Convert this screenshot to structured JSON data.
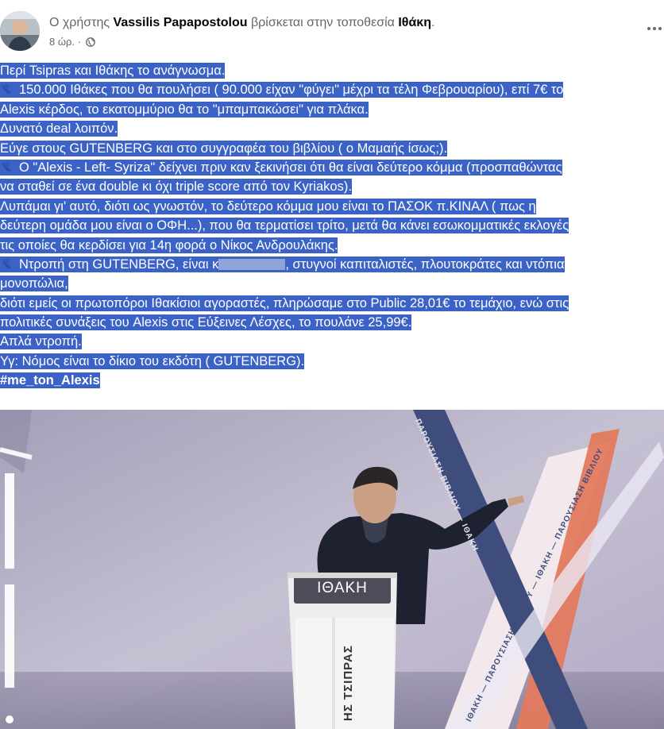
{
  "post_header": {
    "prefix": "Ο χρήστης",
    "author": "Vassilis Papapostolou",
    "middle": "βρίσκεται στην τοποθεσία",
    "location": "Ιθάκη",
    "suffix": ".",
    "time": "8 ώρ. ·",
    "privacy_icon": "globe-icon",
    "more_icon": "more-options-icon"
  },
  "post_lines": [
    "Περί Tsipras και Ιθάκης το ανάγνωσμα.",
    "150.000 Ιθάκες που θα πουλήσει ( 90.000 είχαν \"φύγει\" μέχρι τα τέλη Φεβρουαρίου), επί 7€ το",
    "Alexis κέρδος, το εκατομμύριο θα το \"μπαμπακώσει\" για πλάκα.",
    "Δυνατό deal λοιπόν.",
    "Εύγε στους GUTENBERG και στο συγγραφέα του βιβλίου ( ο Μαμαής ίσως;).",
    "Ο \"Alexis - Left- Syriza\" δείχνει πριν καν ξεκινήσει ότι θα είναι δεύτερο κόμμα (προσπαθώντας",
    "να σταθεί σε ένα double κι όχι triple score  από τον Kyriakos).",
    "Λυπάμαι γι' αυτό, διότι ως γνωστόν, το δεύτερο κόμμα μου είναι το ΠΑΣΟΚ π.ΚΙΝΑΛ ( πως η",
    "δεύτερη ομάδα μου είναι ο ΟΦΗ...), που θα τερματίσει τρίτο, μετά θα κάνει εσωκομματικές εκλογές",
    "τις οποίες θα κερδίσει για 14η φορά ο Νίκος Ανδρουλάκης.",
    "Ντροπή στη GUTENBERG, είναι κ",
    ", στυγνοί καπιταλιστές, πλουτοκράτες και ντόπια",
    "μονοπώλια,",
    "διότι εμείς οι πρωτοπόροι Ιθακίσιοι αγοραστές, πληρώσαμε στο Public 28,01€ το τεμάχιο, ενώ στις",
    "πολιτικές συνάξεις του Alexis στις Εύξεινες Λέσχες, το πουλάνε 25,99€.",
    "Απλά ντροπή.",
    "Υγ: Νόμος είναι το δίκιο του εκδότη ( GUTENBERG).",
    "#me_ton_Alexis"
  ],
  "photo": {
    "podium_sign": "ΙΘΑΚΗ",
    "podium_side": "ΗΣ ΤΣΙΠΡΑΣ",
    "big_letters": "ΙΘΑΚ",
    "banner_text": "ΙΘΑΚΗ — ΠΑΡΟΥΣΙΑΣΗ ΒΙΒΛΙΟΥ — ΙΘΑΚΗ — ΠΑΡΟΥΣΙΑΣΗ ΒΙΒΛΙΟΥ",
    "banner_text_2": "ΠΑΡΟΥΣΙΑΣΗ ΒΙΒΛΙΟΥ — ΙΘΑΚΗ",
    "colors": {
      "backdrop": "#b9b3c8",
      "podium": "#eeeeee",
      "highlight": "#3b63c7"
    }
  }
}
